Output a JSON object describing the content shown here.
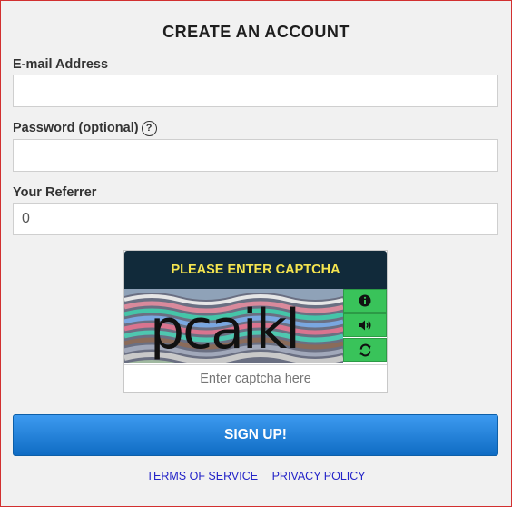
{
  "form": {
    "title": "CREATE AN ACCOUNT",
    "email_label": "E-mail Address",
    "email_value": "",
    "password_label": "Password (optional)",
    "password_help_icon": "question-circle-icon",
    "password_value": "",
    "referrer_label": "Your Referrer",
    "referrer_value": "0"
  },
  "captcha": {
    "heading": "PLEASE ENTER CAPTCHA",
    "image_text": "pcaikl",
    "buttons": [
      "info-icon",
      "audio-icon",
      "refresh-icon"
    ],
    "input_placeholder": "Enter captcha here",
    "header_color": "#112a3a",
    "heading_color": "#f5e54f",
    "button_color": "#39c35a"
  },
  "actions": {
    "signup_label": "SIGN UP!",
    "terms_label": "TERMS OF SERVICE",
    "privacy_label": "PRIVACY POLICY"
  }
}
